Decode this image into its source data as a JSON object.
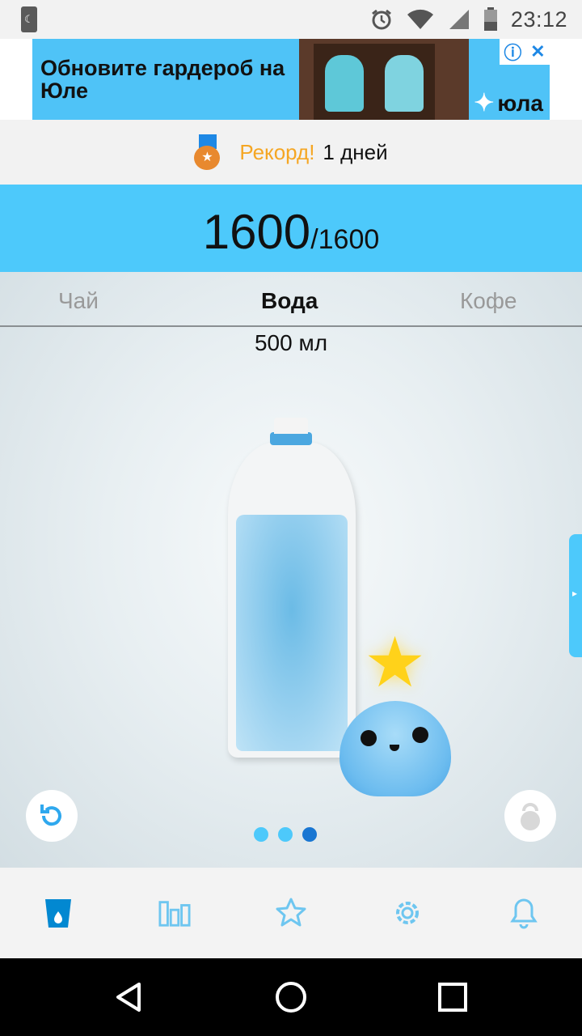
{
  "status_bar": {
    "time": "23:12"
  },
  "ad": {
    "text": "Обновите гардероб на Юле",
    "brand": "юла",
    "info_icon": "info-icon",
    "close_icon": "close-icon"
  },
  "record": {
    "label": "Рекорд!",
    "value": "1 дней",
    "icon": "medal-icon"
  },
  "counter": {
    "current": "1600",
    "goal": "/1600"
  },
  "tabs": [
    {
      "label": "Чай",
      "active": false
    },
    {
      "label": "Вода",
      "active": true
    },
    {
      "label": "Кофе",
      "active": false
    }
  ],
  "drink": {
    "volume": "500 мл"
  },
  "pager": {
    "pages": 3,
    "active_index": 2
  },
  "bottom_nav": [
    {
      "icon": "cup-icon",
      "active": true
    },
    {
      "icon": "stats-icon",
      "active": false
    },
    {
      "icon": "star-icon",
      "active": false
    },
    {
      "icon": "settings-icon",
      "active": false
    },
    {
      "icon": "bell-icon",
      "active": false
    }
  ],
  "colors": {
    "accent": "#4dc9fb",
    "record": "#f5a623",
    "active_nav": "#0288d1",
    "inactive_nav": "#6ec6f0"
  }
}
